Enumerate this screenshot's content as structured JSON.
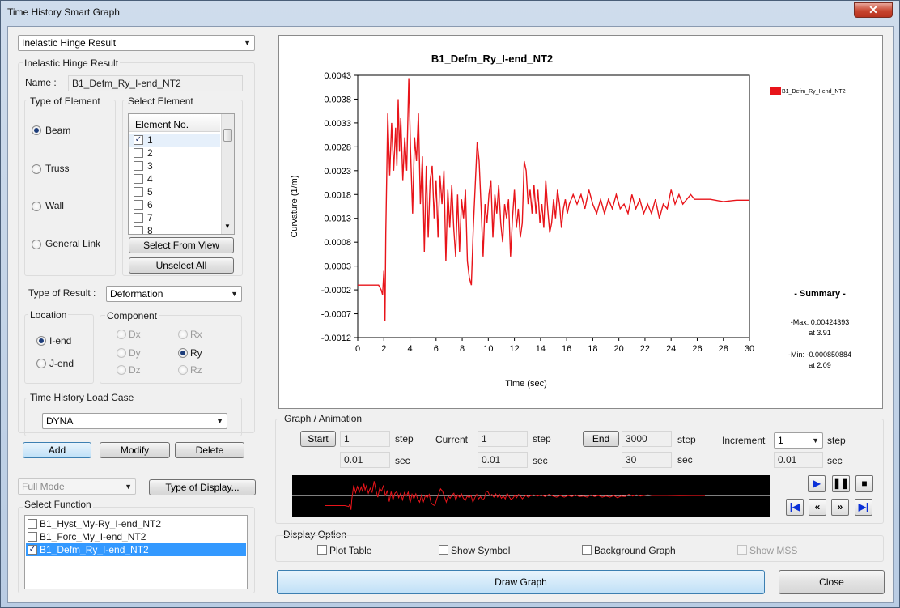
{
  "window": {
    "title": "Time History Smart Graph",
    "close_glyph": "✕"
  },
  "left": {
    "result_type": "Inelastic Hinge Result",
    "group_title": "Inelastic Hinge Result",
    "name_label": "Name :",
    "name_value": "B1_Defm_Ry_I-end_NT2",
    "type_of_element": {
      "title": "Type of Element",
      "options": [
        "Beam",
        "Truss",
        "Wall",
        "General Link"
      ],
      "selected": "Beam"
    },
    "select_element": {
      "title": "Select Element",
      "header": "Element No.",
      "items": [
        "1",
        "2",
        "3",
        "4",
        "5",
        "6",
        "7",
        "8"
      ],
      "checked": [
        "1"
      ]
    },
    "select_from_view": "Select From View",
    "unselect_all": "Unselect All",
    "type_of_result_label": "Type of Result :",
    "type_of_result_value": "Deformation",
    "location": {
      "title": "Location",
      "options": [
        "I-end",
        "J-end"
      ],
      "selected": "I-end"
    },
    "component": {
      "title": "Component",
      "col1": [
        "Dx",
        "Dy",
        "Dz"
      ],
      "col2": [
        "Rx",
        "Ry",
        "Rz"
      ],
      "selected": "Ry"
    },
    "load_case": {
      "title": "Time History Load Case",
      "value": "DYNA"
    },
    "add": "Add",
    "modify": "Modify",
    "delete": "Delete",
    "mode": "Full Mode",
    "type_of_display": "Type of Display...",
    "select_function": {
      "title": "Select Function",
      "items": [
        "B1_Hyst_My-Ry_I-end_NT2",
        "B1_Forc_My_I-end_NT2",
        "B1_Defm_Ry_I-end_NT2"
      ],
      "checked": [
        "B1_Defm_Ry_I-end_NT2"
      ]
    }
  },
  "chart_data": {
    "type": "line",
    "title": "B1_Defm_Ry_I-end_NT2",
    "xlabel": "Time (sec)",
    "ylabel": "Curvature (1/m)",
    "xlim": [
      0,
      30
    ],
    "ylim": [
      -0.0012,
      0.0043
    ],
    "xticks": [
      "0",
      "2",
      "4",
      "6",
      "8",
      "10",
      "12",
      "14",
      "16",
      "18",
      "20",
      "22",
      "24",
      "26",
      "28",
      "30"
    ],
    "yticks": [
      "0.0043",
      "0.0038",
      "0.0033",
      "0.0028",
      "0.0023",
      "0.0018",
      "0.0013",
      "0.0008",
      "0.0003",
      "-0.0002",
      "-0.0007",
      "-0.0012"
    ],
    "legend": {
      "position": "top-right",
      "entry": "B1_Defm_Ry_I-end_NT2"
    },
    "grid": false,
    "series": [
      {
        "name": "B1_Defm_Ry_I-end_NT2",
        "color": "#e8141a",
        "points": [
          [
            0,
            -0.0001
          ],
          [
            1.6,
            -0.0001
          ],
          [
            1.8,
            -0.0002
          ],
          [
            1.9,
            -0.0003
          ],
          [
            2.0,
            0.0002
          ],
          [
            2.09,
            -0.00085
          ],
          [
            2.15,
            0.001
          ],
          [
            2.3,
            0.0035
          ],
          [
            2.45,
            0.0022
          ],
          [
            2.6,
            0.0033
          ],
          [
            2.75,
            0.0023
          ],
          [
            2.9,
            0.0032
          ],
          [
            3.0,
            0.0024
          ],
          [
            3.1,
            0.0038
          ],
          [
            3.2,
            0.0027
          ],
          [
            3.3,
            0.0034
          ],
          [
            3.45,
            0.0021
          ],
          [
            3.6,
            0.003
          ],
          [
            3.75,
            0.0023
          ],
          [
            3.91,
            0.00424
          ],
          [
            4.05,
            0.0027
          ],
          [
            4.2,
            0.0014
          ],
          [
            4.35,
            0.003
          ],
          [
            4.5,
            0.0025
          ],
          [
            4.65,
            0.0035
          ],
          [
            4.8,
            0.0016
          ],
          [
            4.95,
            0.0026
          ],
          [
            5.1,
            0.0006
          ],
          [
            5.25,
            0.0024
          ],
          [
            5.4,
            0.0009
          ],
          [
            5.55,
            0.0021
          ],
          [
            5.7,
            0.0024
          ],
          [
            5.85,
            0.0013
          ],
          [
            6.0,
            0.0021
          ],
          [
            6.15,
            0.0009
          ],
          [
            6.3,
            0.0022
          ],
          [
            6.45,
            0.0016
          ],
          [
            6.6,
            0.0023
          ],
          [
            6.75,
            0.0004
          ],
          [
            6.9,
            0.0019
          ],
          [
            7.05,
            0.0011
          ],
          [
            7.2,
            0.002
          ],
          [
            7.35,
            0.0011
          ],
          [
            7.5,
            0.0005
          ],
          [
            7.65,
            0.0018
          ],
          [
            7.8,
            0.0006
          ],
          [
            7.95,
            0.0017
          ],
          [
            8.1,
            0.0013
          ],
          [
            8.25,
            0.0019
          ],
          [
            8.4,
            0.0004
          ],
          [
            8.55,
            5e-05
          ],
          [
            8.7,
            -0.0001
          ],
          [
            8.85,
            0.0011
          ],
          [
            9.0,
            0.002
          ],
          [
            9.15,
            0.0029
          ],
          [
            9.3,
            0.0025
          ],
          [
            9.45,
            0.0015
          ],
          [
            9.6,
            0.0005
          ],
          [
            9.75,
            0.0016
          ],
          [
            9.9,
            0.0012
          ],
          [
            10.05,
            0.0018
          ],
          [
            10.2,
            0.0021
          ],
          [
            10.35,
            0.0009
          ],
          [
            10.5,
            0.0018
          ],
          [
            10.65,
            0.0014
          ],
          [
            10.8,
            0.002
          ],
          [
            10.95,
            0.0012
          ],
          [
            11.1,
            0.0008
          ],
          [
            11.25,
            0.0016
          ],
          [
            11.4,
            0.0013
          ],
          [
            11.55,
            0.0017
          ],
          [
            11.7,
            0.0005
          ],
          [
            11.85,
            0.0013
          ],
          [
            12.0,
            0.0019
          ],
          [
            12.15,
            0.0011
          ],
          [
            12.3,
            0.0015
          ],
          [
            12.45,
            0.0009
          ],
          [
            12.6,
            0.0012
          ],
          [
            12.75,
            0.0025
          ],
          [
            12.9,
            0.0023
          ],
          [
            13.05,
            0.0016
          ],
          [
            13.2,
            0.0019
          ],
          [
            13.35,
            0.0014
          ],
          [
            13.5,
            0.002
          ],
          [
            13.65,
            0.0014
          ],
          [
            13.8,
            0.0019
          ],
          [
            13.95,
            0.0012
          ],
          [
            14.1,
            0.0016
          ],
          [
            14.25,
            0.0011
          ],
          [
            14.4,
            0.0021
          ],
          [
            14.55,
            0.0015
          ],
          [
            14.7,
            0.001
          ],
          [
            14.85,
            0.0012
          ],
          [
            15.0,
            0.0017
          ],
          [
            15.15,
            0.0013
          ],
          [
            15.3,
            0.0019
          ],
          [
            15.45,
            0.0016
          ],
          [
            15.6,
            0.0011
          ],
          [
            15.75,
            0.0015
          ],
          [
            15.9,
            0.0017
          ],
          [
            16.05,
            0.0014
          ],
          [
            16.2,
            0.0016
          ],
          [
            16.5,
            0.0018
          ],
          [
            16.8,
            0.0016
          ],
          [
            17.1,
            0.0018
          ],
          [
            17.4,
            0.0015
          ],
          [
            17.7,
            0.0019
          ],
          [
            18.0,
            0.0016
          ],
          [
            18.3,
            0.0014
          ],
          [
            18.6,
            0.0017
          ],
          [
            18.9,
            0.0014
          ],
          [
            19.2,
            0.0017
          ],
          [
            19.5,
            0.0015
          ],
          [
            19.8,
            0.0018
          ],
          [
            20.1,
            0.0015
          ],
          [
            20.4,
            0.0016
          ],
          [
            20.7,
            0.0014
          ],
          [
            21.0,
            0.0018
          ],
          [
            21.3,
            0.0015
          ],
          [
            21.6,
            0.0017
          ],
          [
            21.9,
            0.0014
          ],
          [
            22.2,
            0.0016
          ],
          [
            22.5,
            0.0014
          ],
          [
            22.8,
            0.0017
          ],
          [
            23.1,
            0.0013
          ],
          [
            23.4,
            0.0016
          ],
          [
            23.7,
            0.0015
          ],
          [
            24.0,
            0.0019
          ],
          [
            24.3,
            0.0016
          ],
          [
            24.6,
            0.0018
          ],
          [
            24.9,
            0.0016
          ],
          [
            25.2,
            0.0017
          ],
          [
            25.5,
            0.0018
          ],
          [
            25.8,
            0.0017
          ],
          [
            26.2,
            0.0017
          ],
          [
            27.0,
            0.0017
          ],
          [
            28.0,
            0.00165
          ],
          [
            29.0,
            0.00168
          ],
          [
            30.0,
            0.00168
          ]
        ]
      }
    ]
  },
  "summary": {
    "title": "- Summary -",
    "max_text": "-Max: 0.00424393",
    "max_at": "at 3.91",
    "min_text": "-Min: -0.000850884",
    "min_at": "at 2.09"
  },
  "graph_animation": {
    "title": "Graph / Animation",
    "start_btn": "Start",
    "start_step": "1",
    "start_sec": "0.01",
    "current_label": "Current",
    "current_step": "1",
    "current_sec": "0.01",
    "end_btn": "End",
    "end_step": "3000",
    "end_sec": "30",
    "increment_label": "Increment",
    "increment_value": "1",
    "increment_sec": "0.01",
    "step_unit": "step",
    "sec_unit": "sec"
  },
  "display_option": {
    "title": "Display Option",
    "plot_table": "Plot Table",
    "show_symbol": "Show Symbol",
    "background_graph": "Background Graph",
    "show_mss": "Show MSS"
  },
  "footer": {
    "draw_graph": "Draw Graph",
    "close": "Close"
  }
}
